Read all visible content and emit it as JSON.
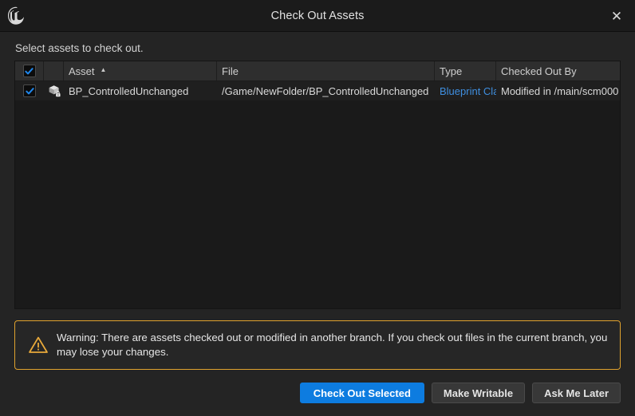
{
  "window": {
    "logo_icon": "unreal-engine-logo",
    "title": "Check Out Assets",
    "close_icon": "✕"
  },
  "instruction": "Select assets to check out.",
  "table": {
    "columns": [
      {
        "key": "select",
        "label": "",
        "icon": "select-all-checkbox"
      },
      {
        "key": "icon",
        "label": ""
      },
      {
        "key": "asset",
        "label": "Asset",
        "sorted": "ascending",
        "sort_glyph": "▲"
      },
      {
        "key": "file",
        "label": "File"
      },
      {
        "key": "type",
        "label": "Type"
      },
      {
        "key": "checked_out_by",
        "label": "Checked Out By"
      }
    ],
    "header_select_all_checked": true,
    "rows": [
      {
        "checked": true,
        "icon": "blueprint-locked-icon",
        "asset": "BP_ControlledUnchanged",
        "file": "/Game/NewFolder/BP_ControlledUnchanged",
        "type": "Blueprint Class",
        "checked_out_by": "Modified in /main/scm000"
      }
    ]
  },
  "warning": {
    "icon": "warning-triangle-icon",
    "text": "Warning: There are assets checked out or modified in another branch.  If you check out files in the current branch, you may lose your changes.",
    "accent_color": "#e0a22e"
  },
  "buttons": {
    "primary": "Check Out Selected",
    "make_writable": "Make Writable",
    "ask_me_later": "Ask Me Later",
    "primary_color": "#0d7ce0"
  }
}
